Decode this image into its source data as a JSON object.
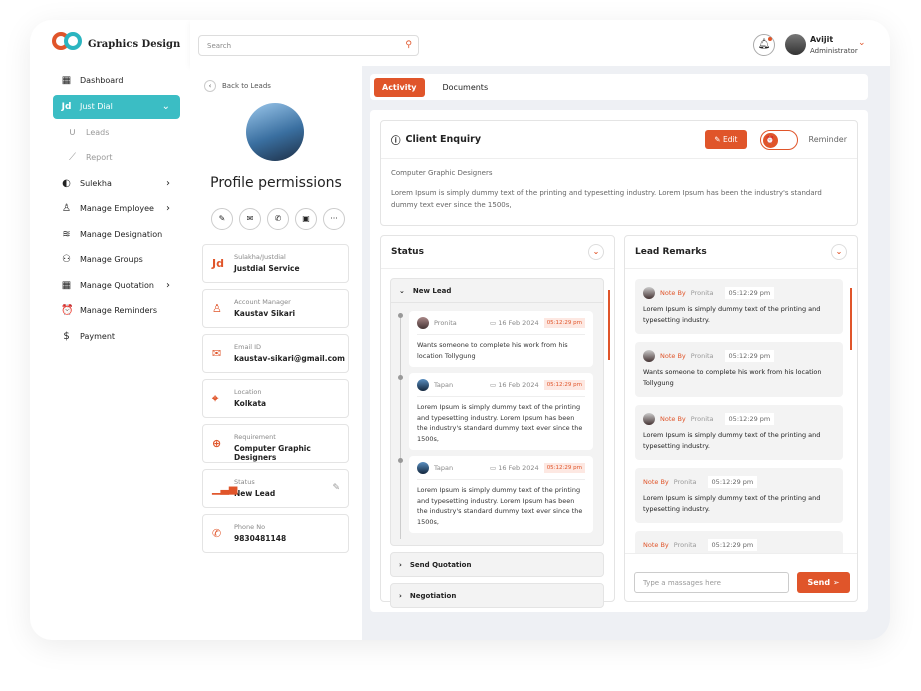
{
  "brand": {
    "name": "Graphics Design",
    "accent": "#e0552a",
    "teal": "#3bbdc4"
  },
  "sidebar": {
    "items": [
      {
        "label": "Dashboard",
        "icon": "dashboard-icon",
        "glyph": "▦"
      },
      {
        "label": "Just Dial",
        "icon": "justdial-icon",
        "glyph": "Jd",
        "active": true,
        "chevron": "⌄"
      },
      {
        "label": "Leads",
        "icon": "magnet-icon",
        "glyph": "∪",
        "sub": true
      },
      {
        "label": "Report",
        "icon": "chart-icon",
        "glyph": "⟋",
        "sub": true
      },
      {
        "label": "Sulekha",
        "icon": "sulekha-icon",
        "glyph": "◐",
        "chevron": "›"
      },
      {
        "label": "Manage Employee",
        "icon": "user-icon",
        "glyph": "♙",
        "chevron": "›"
      },
      {
        "label": "Manage Designation",
        "icon": "layers-icon",
        "glyph": "≋"
      },
      {
        "label": "Manage Groups",
        "icon": "group-icon",
        "glyph": "⚇"
      },
      {
        "label": "Manage Quotation",
        "icon": "grid-icon",
        "glyph": "▦",
        "chevron": "›"
      },
      {
        "label": "Manage Reminders",
        "icon": "alarm-icon",
        "glyph": "⏰"
      },
      {
        "label": "Payment",
        "icon": "dollar-icon",
        "glyph": "$"
      }
    ]
  },
  "header": {
    "search_placeholder": "Search",
    "user_name": "Avijit",
    "user_role": "Administrator"
  },
  "profile": {
    "back_label": "Back to Leads",
    "title": "Profile permissions",
    "actions": [
      {
        "icon": "edit-icon",
        "glyph": "✎"
      },
      {
        "icon": "mail-icon",
        "glyph": "✉"
      },
      {
        "icon": "phone-icon",
        "glyph": "✆"
      },
      {
        "icon": "calendar-icon",
        "glyph": "▣"
      },
      {
        "icon": "more-icon",
        "glyph": "···"
      }
    ],
    "fields": [
      {
        "label": "Sulakha/Justdial",
        "value": "Justdial Service",
        "icon": "justdial-icon",
        "glyph": "Jd"
      },
      {
        "label": "Account Manager",
        "value": "Kaustav Sikari",
        "icon": "user-icon",
        "glyph": "♙"
      },
      {
        "label": "Email ID",
        "value": "kaustav-sikari@gmail.com",
        "icon": "mail-icon",
        "glyph": "✉"
      },
      {
        "label": "Location",
        "value": "Kolkata",
        "icon": "location-icon",
        "glyph": "⌖"
      },
      {
        "label": "Requirement",
        "value": "Computer Graphic Designers",
        "icon": "globe-icon",
        "glyph": "⊕"
      },
      {
        "label": "Status",
        "value": "New Lead",
        "icon": "signal-icon",
        "glyph": "▁▃▅",
        "editable": true
      },
      {
        "label": "Phone No",
        "value": "9830481148",
        "icon": "phone-icon",
        "glyph": "✆"
      }
    ]
  },
  "tabs": [
    {
      "label": "Activity",
      "active": true
    },
    {
      "label": "Documents"
    }
  ],
  "enquiry": {
    "title": "Client Enquiry",
    "edit_label": "Edit",
    "reminder_label": "Reminder",
    "subtitle": "Computer Graphic Designers",
    "body": "Lorem Ipsum is simply dummy text of the printing and typesetting industry. Lorem Ipsum has been the industry's standard dummy text ever since the 1500s,"
  },
  "status": {
    "title": "Status",
    "stages": [
      {
        "label": "New Lead",
        "expanded": true,
        "events": [
          {
            "user": "Pronita",
            "date": "16 Feb 2024",
            "time": "05:12:29 pm",
            "text": "Wants someone to complete his work from his location Tollygung"
          },
          {
            "user": "Tapan",
            "date": "16 Feb 2024",
            "time": "05:12:29 pm",
            "text": "Lorem Ipsum is simply dummy text of the printing and typesetting industry. Lorem Ipsum has been the industry's standard dummy text ever since the 1500s,"
          },
          {
            "user": "Tapan",
            "date": "16 Feb 2024",
            "time": "05:12:29 pm",
            "text": "Lorem Ipsum is simply dummy text of the printing and typesetting industry. Lorem Ipsum has been the industry's standard dummy text ever since the 1500s,"
          }
        ]
      },
      {
        "label": "Send Quotation"
      },
      {
        "label": "Negotiation"
      }
    ]
  },
  "remarks": {
    "title": "Lead Remarks",
    "note_by": "Note By",
    "notes": [
      {
        "user": "Pronita",
        "time": "05:12:29 pm",
        "text": "Lorem Ipsum is simply dummy text of the printing and typesetting industry.",
        "avatar": true
      },
      {
        "user": "Pronita",
        "time": "05:12:29 pm",
        "text": "Wants someone to complete his work from his location Tollygung",
        "avatar": true
      },
      {
        "user": "Pronita",
        "time": "05:12:29 pm",
        "text": "Lorem Ipsum is simply dummy text of the printing and typesetting industry.",
        "avatar": true
      },
      {
        "user": "Pronita",
        "time": "05:12:29 pm",
        "text": "Lorem Ipsum is simply dummy text of the printing and typesetting industry."
      },
      {
        "user": "Pronita",
        "time": "05:12:29 pm",
        "text": ""
      }
    ],
    "message_placeholder": "Type a massages here",
    "send_label": "Send"
  }
}
